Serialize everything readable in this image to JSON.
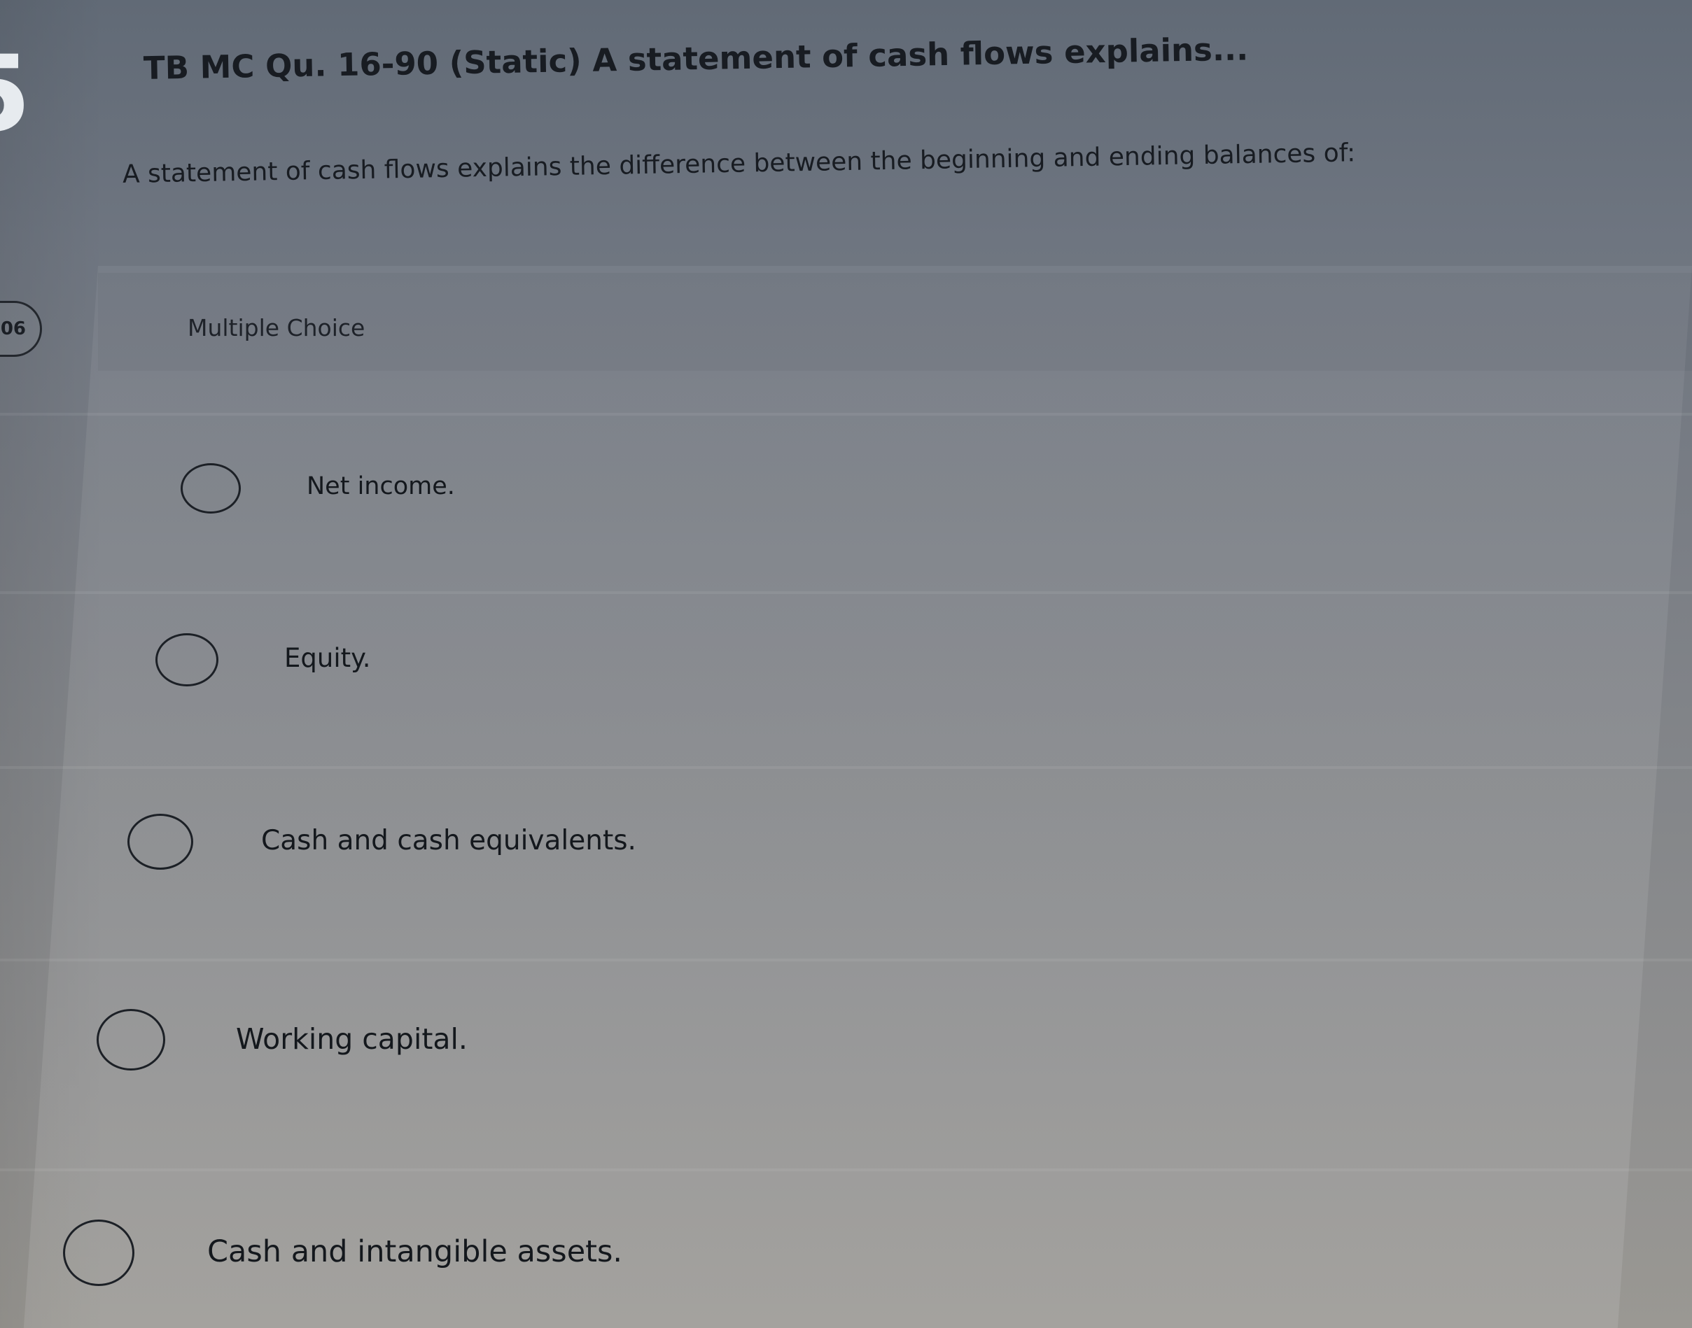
{
  "question": {
    "number": "5",
    "title": "TB MC Qu. 16-90 (Static) A statement of cash flows explains...",
    "prompt": "A statement of cash flows explains the difference between the beginning and ending balances of:",
    "score_badge": "06"
  },
  "answer_panel": {
    "label": "Multiple Choice",
    "choices": [
      {
        "label": "Net income.",
        "selected": false
      },
      {
        "label": "Equity.",
        "selected": false
      },
      {
        "label": "Cash and cash equivalents.",
        "selected": false
      },
      {
        "label": "Working capital.",
        "selected": false
      },
      {
        "label": "Cash and intangible assets.",
        "selected": false
      }
    ]
  },
  "colors": {
    "text": "#181c22",
    "question_number": "#e7ebef",
    "radio_border": "#1c2026"
  },
  "icons": {
    "choice_radio": "radio-button-unchecked-icon"
  }
}
